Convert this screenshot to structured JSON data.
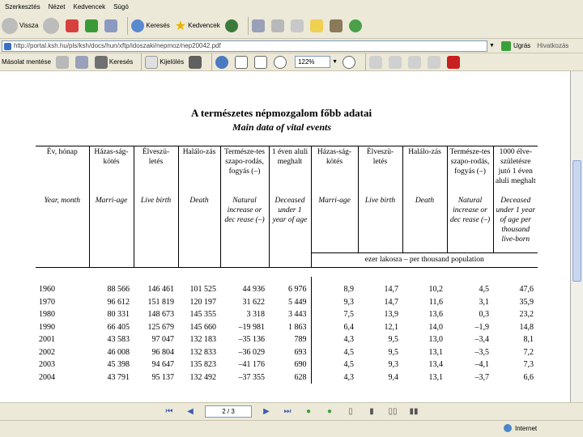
{
  "menu": [
    "Szerkesztés",
    "Nézet",
    "Kedvencek",
    "Súgó"
  ],
  "toolbar": {
    "back": "Vissza",
    "search": "Keresés",
    "favorites": "Kedvencek"
  },
  "address": {
    "url": "http://portal.ksh.hu/pls/ksh/docs/hun/xftp/idoszaki/nepmoz/nep20042.pdf",
    "go": "Ugrás",
    "links": "Hivatkozás"
  },
  "pdf": {
    "save": "Másolat mentése",
    "search": "Keresés",
    "select": "Kijelölés",
    "zoom": "122%"
  },
  "nav": {
    "page": "2 / 3"
  },
  "status": {
    "zone": "Internet"
  },
  "document": {
    "title": "A természetes népmozgalom főbb adatai",
    "subtitle": "Main data of vital events",
    "headers_hu": [
      "Év, hónap",
      "Házas-ság-kötés",
      "Élveszü-letés",
      "Halálo-zás",
      "Természe-tes szapo-rodás, fogyás (–)",
      "1 éven aluli meghalt",
      "Házas-ság-kötés",
      "Élveszü-letés",
      "Halálo-zás",
      "Természe-tes szapo-rodás, fogyás (–)",
      "1000 élve-születésre jutó 1 éven aluli meghalt"
    ],
    "headers_en": [
      "Year, month",
      "Marri-age",
      "Live birth",
      "Death",
      "Natural increase or dec rease (–)",
      "Deceased under 1 year of age",
      "Marri-age",
      "Live birth",
      "Death",
      "Natural increase or dec rease (–)",
      "Deceased under 1 year of age per thousand live-born"
    ],
    "unit": "ezer lakosra – per thousand population",
    "rows": [
      [
        "1960",
        "88 566",
        "146 461",
        "101 525",
        "44 936",
        "6 976",
        "8,9",
        "14,7",
        "10,2",
        "4,5",
        "47,6"
      ],
      [
        "1970",
        "96 612",
        "151 819",
        "120 197",
        "31 622",
        "5 449",
        "9,3",
        "14,7",
        "11,6",
        "3,1",
        "35,9"
      ],
      [
        "1980",
        "80 331",
        "148 673",
        "145 355",
        "3 318",
        "3 443",
        "7,5",
        "13,9",
        "13,6",
        "0,3",
        "23,2"
      ],
      [
        "1990",
        "66 405",
        "125 679",
        "145 660",
        "–19 981",
        "1 863",
        "6,4",
        "12,1",
        "14,0",
        "–1,9",
        "14,8"
      ],
      [
        "2001",
        "43 583",
        "97 047",
        "132 183",
        "–35 136",
        "789",
        "4,3",
        "9,5",
        "13,0",
        "–3,4",
        "8,1"
      ],
      [
        "2002",
        "46 008",
        "96 804",
        "132 833",
        "–36 029",
        "693",
        "4,5",
        "9,5",
        "13,1",
        "–3,5",
        "7,2"
      ],
      [
        "2003",
        "45 398",
        "94 647",
        "135 823",
        "–41 176",
        "690",
        "4,5",
        "9,3",
        "13,4",
        "–4,1",
        "7,3"
      ],
      [
        "2004",
        "43 791",
        "95 137",
        "132 492",
        "–37 355",
        "628",
        "4,3",
        "9,4",
        "13,1",
        "–3,7",
        "6,6"
      ]
    ]
  }
}
